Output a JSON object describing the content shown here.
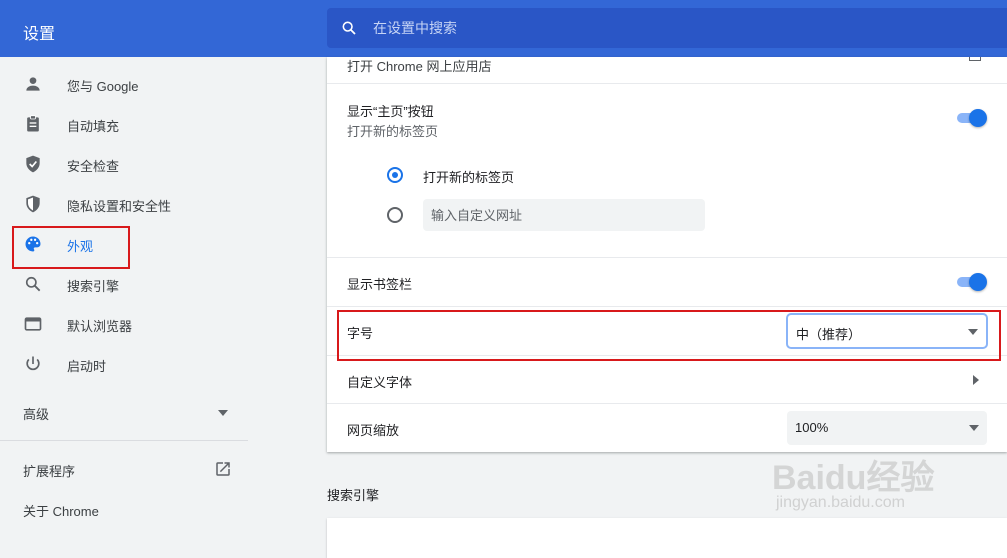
{
  "app": {
    "title": "设置"
  },
  "search": {
    "placeholder": "在设置中搜索"
  },
  "sidebar": {
    "items": [
      {
        "label": "您与 Google",
        "icon": "person-icon"
      },
      {
        "label": "自动填充",
        "icon": "clipboard-icon"
      },
      {
        "label": "安全检查",
        "icon": "shield-check-icon"
      },
      {
        "label": "隐私设置和安全性",
        "icon": "shield-half-icon"
      },
      {
        "label": "外观",
        "icon": "palette-icon",
        "active": true
      },
      {
        "label": "搜索引擎",
        "icon": "search-icon"
      },
      {
        "label": "默认浏览器",
        "icon": "browser-icon"
      },
      {
        "label": "启动时",
        "icon": "power-icon"
      }
    ],
    "advanced": "高级",
    "extensions": "扩展程序",
    "about": "关于 Chrome"
  },
  "appearance": {
    "webstore_link": "打开 Chrome 网上应用店",
    "home_button": {
      "label": "显示“主页”按钮",
      "sub": "打开新的标签页",
      "enabled": true
    },
    "home_options": {
      "new_tab": "打开新的标签页",
      "custom_url_placeholder": "输入自定义网址"
    },
    "bookmarks_bar": {
      "label": "显示书签栏",
      "enabled": true
    },
    "font_size": {
      "label": "字号",
      "value": "中（推荐）"
    },
    "custom_fonts": {
      "label": "自定义字体"
    },
    "page_zoom": {
      "label": "网页缩放",
      "value": "100%"
    }
  },
  "search_engine_section": {
    "title": "搜索引擎"
  },
  "colors": {
    "header": "#3367d6",
    "accent": "#1a73e8",
    "highlight": "#d8191b"
  },
  "watermark": {
    "brand": "Baidu经验",
    "domain": "jingyan.baidu.com"
  }
}
